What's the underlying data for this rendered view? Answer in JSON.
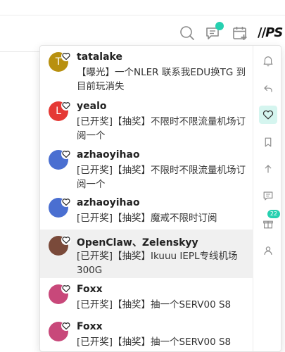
{
  "colors": {
    "accent": "#26d0b0",
    "icon_gray": "#8a8a8a"
  },
  "header": {
    "icons": [
      "search-icon",
      "chat-bubble-icon",
      "calendar-plus-icon"
    ],
    "brand_text": "PS"
  },
  "notifications": [
    {
      "username": "tatalake",
      "avatar_letter": "T",
      "avatar_color": "#b8900f",
      "text": "【曝光】一个NLER 联系我EDU换TG 到目前玩消失",
      "icon": "heart-icon"
    },
    {
      "username": "yealo",
      "avatar_letter": "L",
      "avatar_color": "#e53935",
      "text": "[已开奖]【抽奖】不限时不限流量机场订阅一个",
      "icon": "heart-icon"
    },
    {
      "username": "azhaoyihao",
      "avatar_letter": "",
      "avatar_color": "#4a6fd1",
      "text": "[已开奖]【抽奖】不限时不限流量机场订阅一个",
      "icon": "heart-icon"
    },
    {
      "username": "azhaoyihao",
      "avatar_letter": "",
      "avatar_color": "#4a6fd1",
      "text": "[已开奖]【抽奖】魔戒不限时订阅",
      "icon": "heart-icon"
    },
    {
      "username": "OpenClaw、Zelenskyy",
      "avatar_letter": "",
      "avatar_color": "#7a4a3a",
      "text": "[已开奖]【抽奖】Ikuuu IEPL专线机场300G",
      "icon": "heart-icon"
    },
    {
      "username": "Foxx",
      "avatar_letter": "",
      "avatar_color": "#c8487a",
      "text": "[已开奖]【抽奖】抽一个SERV00 S8",
      "icon": "heart-icon"
    },
    {
      "username": "Foxx",
      "avatar_letter": "",
      "avatar_color": "#c8487a",
      "text": "[已开奖]【抽奖】抽一个SERV00 S8",
      "icon": "heart-icon"
    }
  ],
  "side_tabs": [
    {
      "icon": "bell-icon"
    },
    {
      "icon": "reply-icon"
    },
    {
      "icon": "heart-icon"
    },
    {
      "icon": "bookmark-icon"
    },
    {
      "icon": "arrow-up-icon"
    },
    {
      "icon": "message-icon"
    },
    {
      "icon": "gift-icon",
      "badge": "22"
    },
    {
      "icon": "user-icon"
    }
  ]
}
